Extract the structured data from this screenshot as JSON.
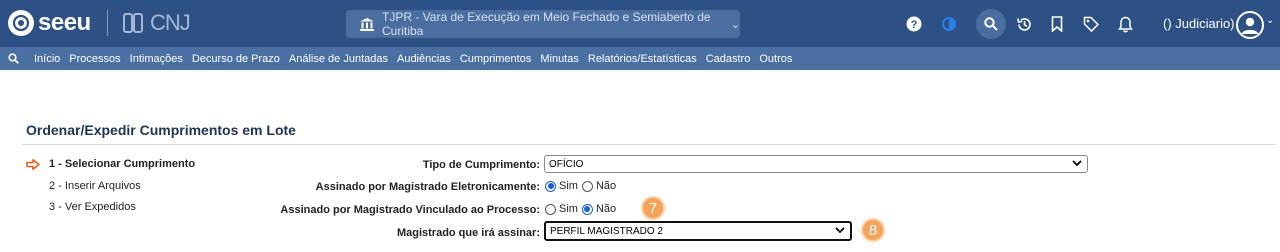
{
  "header": {
    "logo_text": "seeu",
    "cnj_text": "CNJ",
    "court_selector": "TJPR - Vara de Execução em Meio Fechado e Semiaberto de Curitiba",
    "user_label": "() Judiciario)",
    "icons": [
      "help-icon",
      "theme-icon",
      "search-icon",
      "history-icon",
      "bookmark-icon",
      "tag-icon",
      "bell-icon",
      "user-avatar-icon"
    ]
  },
  "nav": {
    "items": [
      "Início",
      "Processos",
      "Intimações",
      "Decurso de Prazo",
      "Análise de Juntadas",
      "Audiências",
      "Cumprimentos",
      "Minutas",
      "Relatórios/Estatísticas",
      "Cadastro",
      "Outros"
    ]
  },
  "page": {
    "title": "Ordenar/Expedir Cumprimentos em Lote"
  },
  "steps": [
    {
      "label": "1 - Selecionar Cumprimento",
      "active": true
    },
    {
      "label": "2 - Inserir Arquivos",
      "active": false
    },
    {
      "label": "3 - Ver Expedidos",
      "active": false
    }
  ],
  "form": {
    "tipo_label": "Tipo de Cumprimento:",
    "tipo_value": "OFÍCIO",
    "assinado_eletr_label": "Assinado por Magistrado Eletronicamente:",
    "assinado_eletr_sim": "Sim",
    "assinado_eletr_nao": "Não",
    "assinado_eletr_selected": "Sim",
    "assinado_vinc_label": "Assinado por Magistrado Vinculado ao Processo:",
    "assinado_vinc_sim": "Sim",
    "assinado_vinc_nao": "Não",
    "assinado_vinc_selected": "Não",
    "magistrado_label": "Magistrado que irá assinar:",
    "magistrado_value": "PERFIL MAGISTRADO 2"
  },
  "annotations": {
    "badge_7": "7",
    "badge_8": "8"
  },
  "colors": {
    "topbar": "#2d5184",
    "navbar": "#4a6fa2",
    "title": "#1f3554",
    "badge": "#f3a45a",
    "step_arrow": "#e8601c",
    "radio_selected": "#1a5fd6"
  }
}
